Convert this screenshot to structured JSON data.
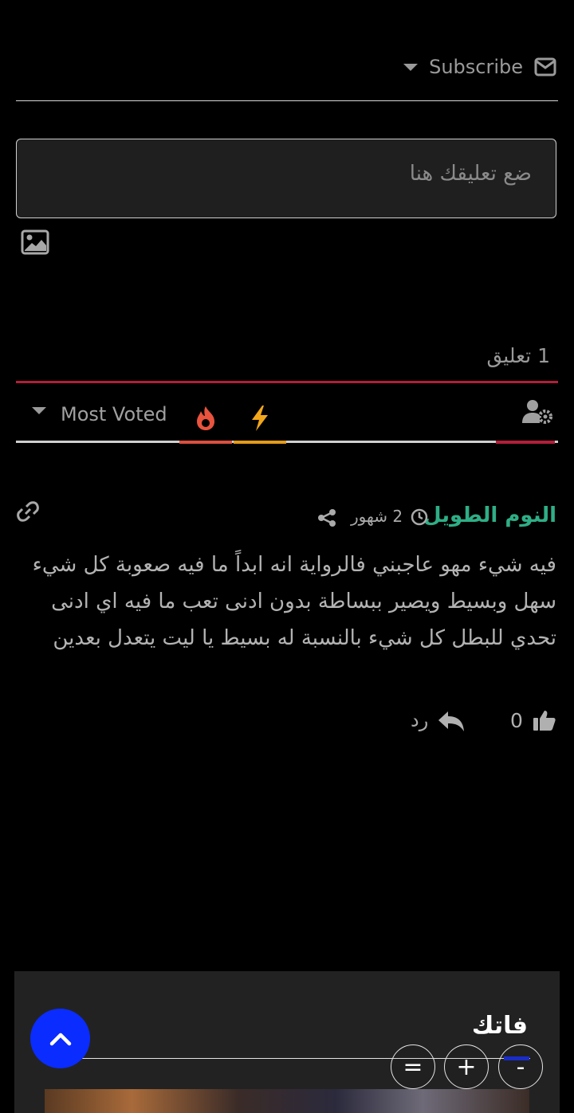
{
  "header": {
    "subscribe_label": "Subscribe"
  },
  "comment_form": {
    "placeholder": "ضع تعليقك هنا"
  },
  "comments_count": "1 تعليق",
  "sort": {
    "selected": "Most Voted"
  },
  "comment": {
    "author": "النوم الطويل",
    "time": "2 شهور",
    "text": "فيه شيء مهو عاجبني فالرواية انه ابداً ما فيه صعوبة كل شيء سهل وبسيط ويصير ببساطة بدون ادنى تعب ما فيه اي ادنى تحدي للبطل كل شيء بالنسبة له بسيط يا ليت يتعدل بعدين",
    "votes": "0",
    "reply_label": "رد"
  },
  "widget": {
    "title": "فاتك",
    "buttons": {
      "equal": "=",
      "plus": "+",
      "minus": "-"
    }
  },
  "colors": {
    "accent_red": "#b21f3a",
    "author_green": "#2fae86",
    "fab_blue": "#0a2cff"
  },
  "icons": [
    "envelope-icon",
    "caret-down-icon",
    "image-icon",
    "flame-icon",
    "bolt-icon",
    "user-settings-icon",
    "link-icon",
    "clock-icon",
    "share-icon",
    "thumbs-up-icon",
    "reply-arrow-icon",
    "chevron-up-icon"
  ]
}
